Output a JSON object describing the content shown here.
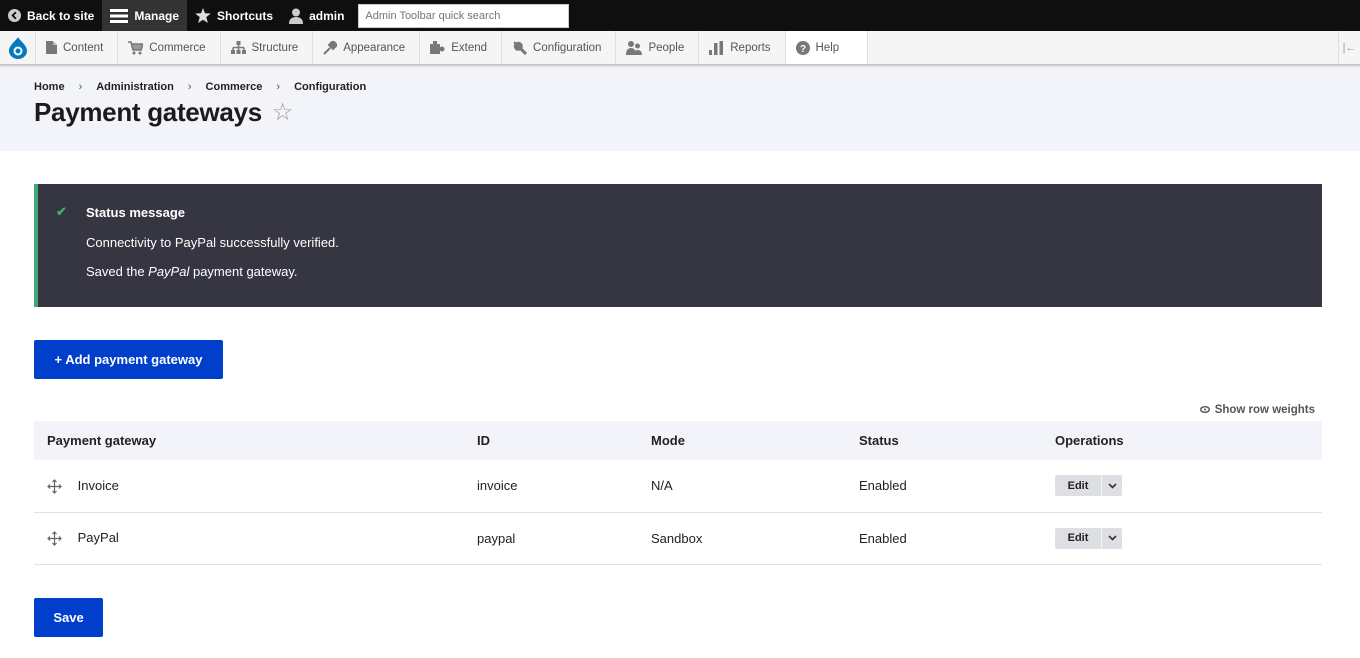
{
  "toolbar": {
    "back_to_site": "Back to site",
    "manage": "Manage",
    "shortcuts": "Shortcuts",
    "user": "admin",
    "search_placeholder": "Admin Toolbar quick search"
  },
  "menu": {
    "items": [
      {
        "label": "Content",
        "icon": "file-icon"
      },
      {
        "label": "Commerce",
        "icon": "cart-icon"
      },
      {
        "label": "Structure",
        "icon": "sitemap-icon"
      },
      {
        "label": "Appearance",
        "icon": "paintbrush-icon"
      },
      {
        "label": "Extend",
        "icon": "puzzle-icon"
      },
      {
        "label": "Configuration",
        "icon": "wrench-icon"
      },
      {
        "label": "People",
        "icon": "people-icon"
      },
      {
        "label": "Reports",
        "icon": "bar-chart-icon"
      },
      {
        "label": "Help",
        "icon": "help-icon"
      }
    ]
  },
  "breadcrumb": [
    "Home",
    "Administration",
    "Commerce",
    "Configuration"
  ],
  "page_title": "Payment gateways",
  "status_message": {
    "title": "Status message",
    "line1": "Connectivity to PayPal successfully verified.",
    "line2_prefix": "Saved the ",
    "line2_em": "PayPal",
    "line2_suffix": " payment gateway."
  },
  "add_button": "+ Add payment gateway",
  "show_row_weights": "Show row weights",
  "table": {
    "headers": [
      "Payment gateway",
      "ID",
      "Mode",
      "Status",
      "Operations"
    ],
    "rows": [
      {
        "name": "Invoice",
        "id": "invoice",
        "mode": "N/A",
        "status": "Enabled",
        "op": "Edit"
      },
      {
        "name": "PayPal",
        "id": "paypal",
        "mode": "Sandbox",
        "status": "Enabled",
        "op": "Edit"
      }
    ]
  },
  "save_button": "Save",
  "colors": {
    "primary": "#003ecc",
    "status_bg": "#353641",
    "status_accent": "#42a877"
  }
}
